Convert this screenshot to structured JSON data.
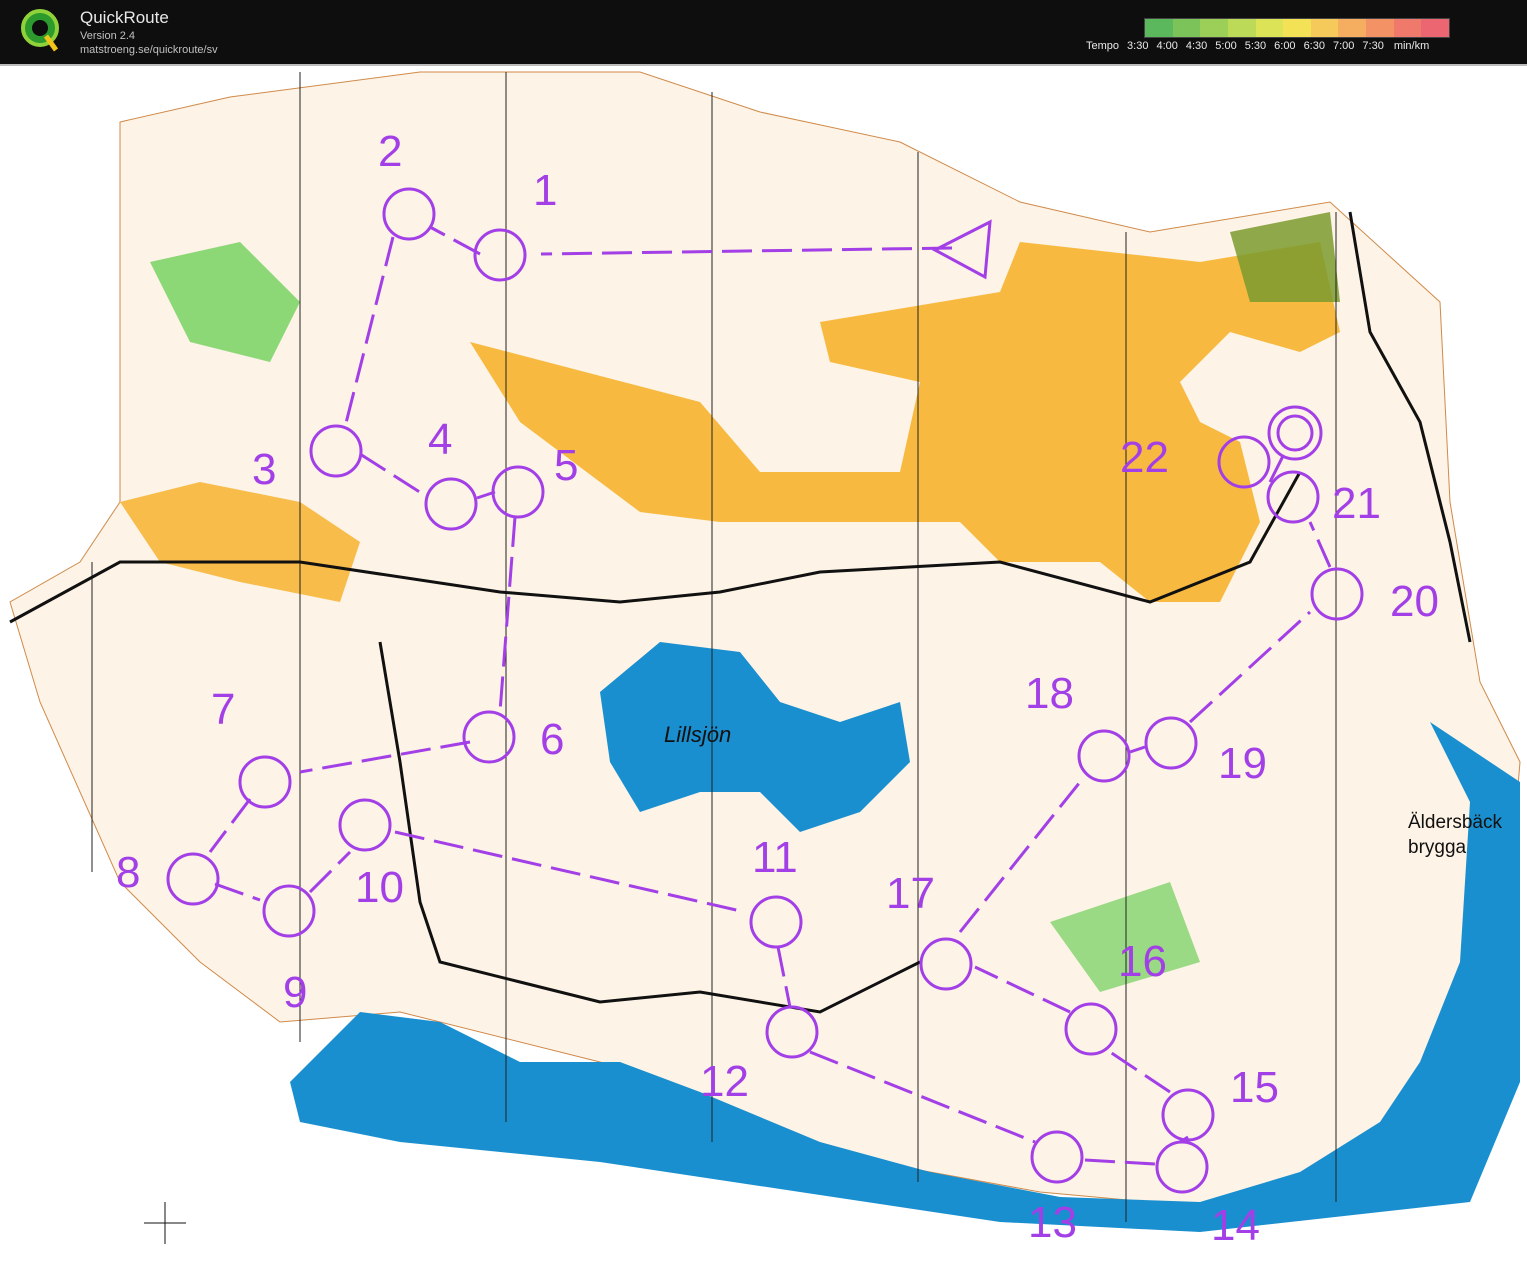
{
  "app": {
    "name": "QuickRoute",
    "version": "Version 2.4",
    "url": "matstroeng.se/quickroute/sv",
    "logo_letter": "Q"
  },
  "legend": {
    "prefix": "Tempo",
    "ticks": [
      "3:30",
      "4:00",
      "4:30",
      "5:00",
      "5:30",
      "6:00",
      "6:30",
      "7:00",
      "7:30"
    ],
    "unit": "min/km",
    "colors": [
      "#5cb85c",
      "#7cc45a",
      "#9ccf58",
      "#bcd957",
      "#dce356",
      "#f3e255",
      "#f5c95a",
      "#f5ad5f",
      "#f29265",
      "#ef7a6c",
      "#ec6672"
    ]
  },
  "map": {
    "lake_name": "Lillsjön",
    "place_name_line1": "Äldersbäck",
    "place_name_line2": "brygga",
    "course_color": "#a33fe6",
    "water_color": "#1a8fcf",
    "open_land_color": "#f6b22e",
    "forest_green_color": "#6fcf5a",
    "controls": [
      "1",
      "2",
      "3",
      "4",
      "5",
      "6",
      "7",
      "8",
      "9",
      "10",
      "11",
      "12",
      "13",
      "14",
      "15",
      "16",
      "17",
      "18",
      "19",
      "20",
      "21",
      "22"
    ]
  }
}
